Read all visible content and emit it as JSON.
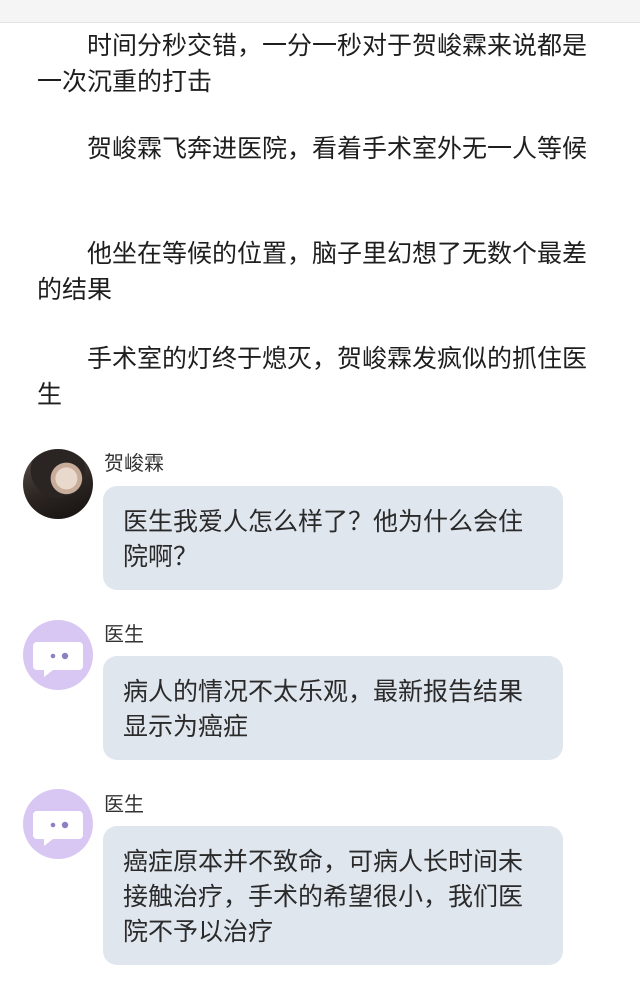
{
  "narration": [
    "时间分秒交错，一分一秒对于贺峻霖来说都是一次沉重的打击",
    "贺峻霖飞奔进医院，看着手术室外无一人等候",
    "他坐在等候的位置，脑子里幻想了无数个最差的结果",
    "手术室的灯终于熄灭，贺峻霖发疯似的抓住医生"
  ],
  "messages": [
    {
      "sender": "贺峻霖",
      "text": "医生我爱人怎么样了？他为什么会住院啊？",
      "avatar": "person-photo"
    },
    {
      "sender": "医生",
      "text": "病人的情况不太乐观，最新报告结果显示为癌症",
      "avatar": "chat-bubble-icon"
    },
    {
      "sender": "医生",
      "text": "癌症原本并不致命，可病人长时间未接触治疗，手术的希望很小，我们医院不予以治疗",
      "avatar": "chat-bubble-icon"
    }
  ],
  "colors": {
    "bubble": "#e0e6ee",
    "doctor_avatar": "#d9c7f3",
    "text": "#1e1e1e"
  }
}
